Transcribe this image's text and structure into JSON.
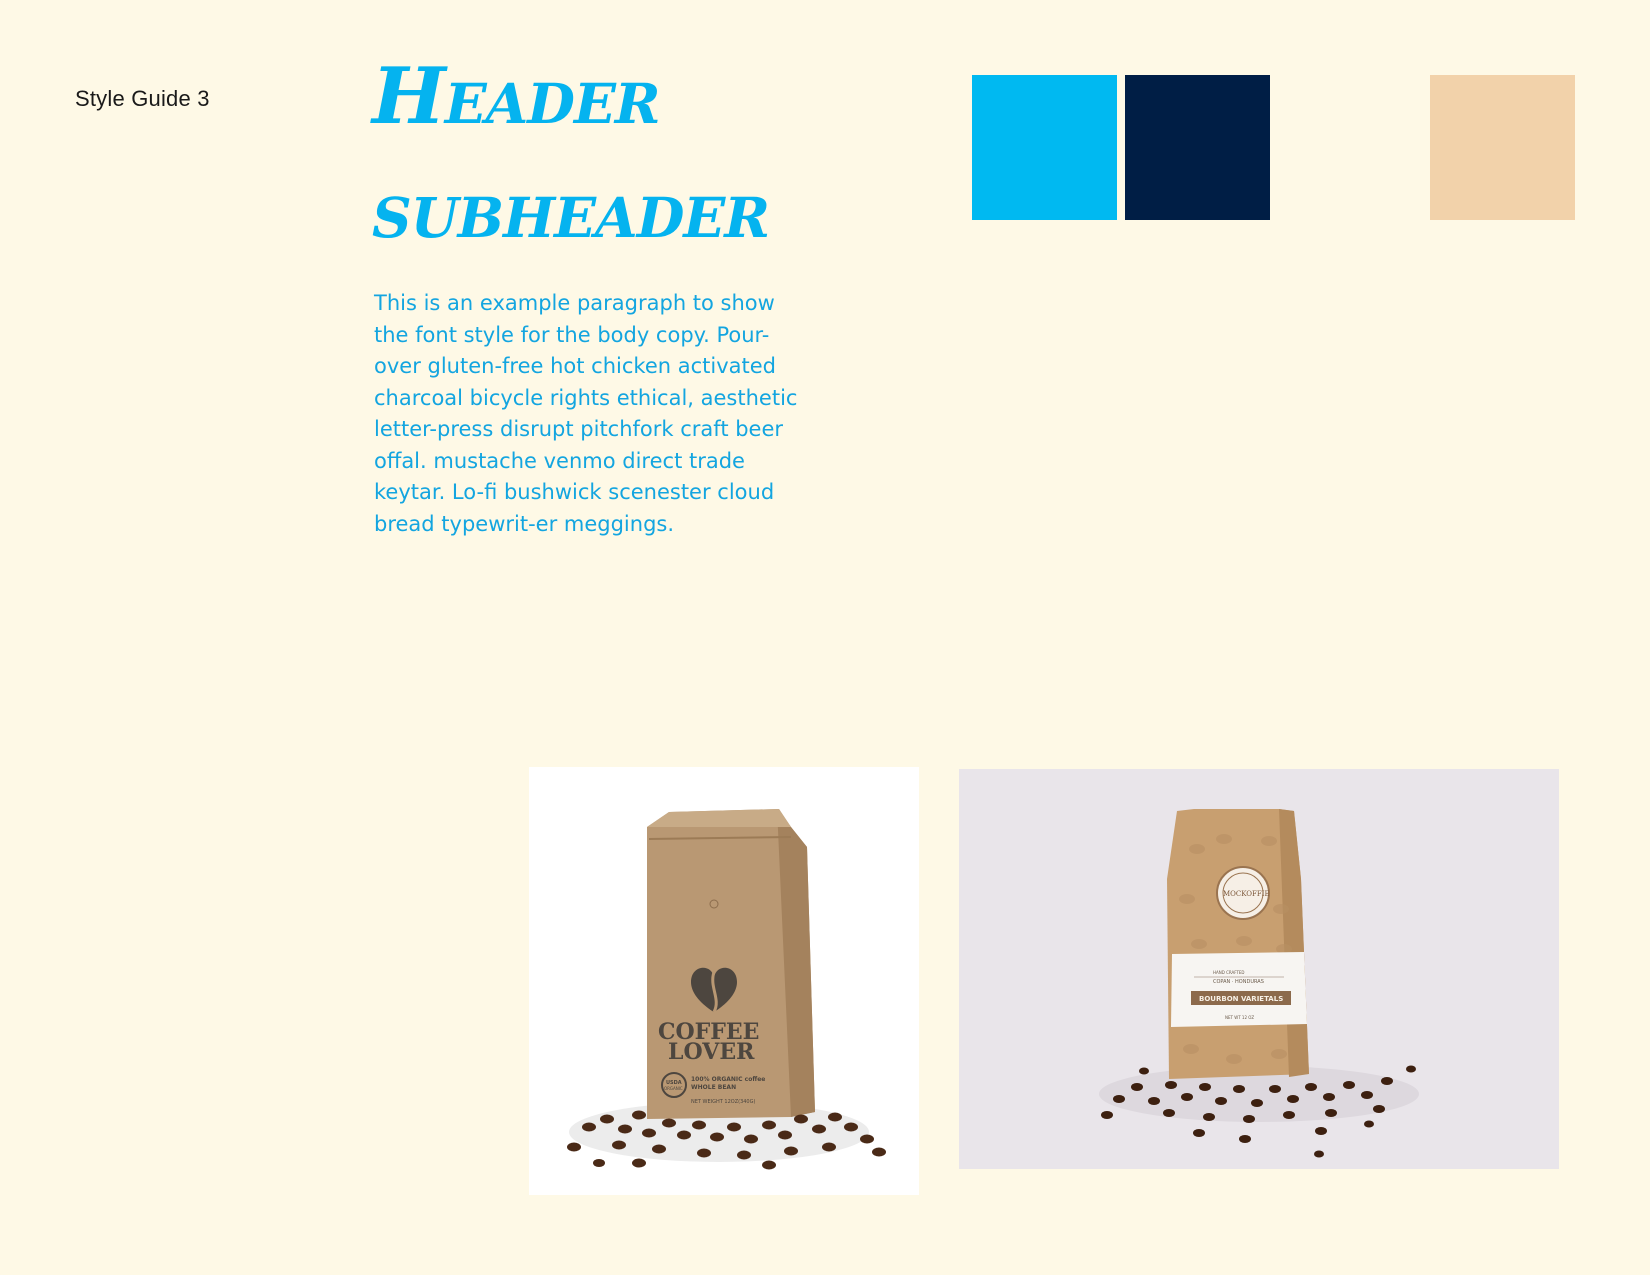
{
  "document": {
    "label": "Style Guide 3",
    "header": "Header",
    "subheader": "subheader",
    "body_copy": "This is an example paragraph to show the font style for the body copy. Pour-over gluten-free hot chicken activated charcoal bicycle rights ethical, aesthetic letter-press disrupt pitchfork craft beer offal. mustache venmo direct trade keytar. Lo-fi bushwick scenester cloud bread typewrit-er meggings."
  },
  "palette": {
    "swatches": [
      {
        "name": "sky-blue",
        "color": "#00b9f1"
      },
      {
        "name": "navy",
        "color": "#001e45"
      },
      {
        "name": "cream",
        "color": "#fef9e6"
      },
      {
        "name": "tan",
        "color": "#f2d2aa"
      }
    ]
  },
  "images": {
    "coffee_lover_bag": {
      "brand_line1": "COFFEE",
      "brand_line2": "LOVER",
      "claim_line1": "100% ORGANIC coffee",
      "claim_line2": "WHOLE BEAN",
      "usda_line1": "USDA",
      "usda_line2": "ORGANIC",
      "net_weight": "NET WEIGHT 12OZ(340G)"
    },
    "bourbon_bag": {
      "seal_text": "MOCKOFFIE",
      "band_small": "HAND CRAFTED",
      "origin": "COPAN · HONDURAS",
      "variety": "BOURBON VARIETALS",
      "net_weight": "NET WT 12 OZ"
    }
  }
}
